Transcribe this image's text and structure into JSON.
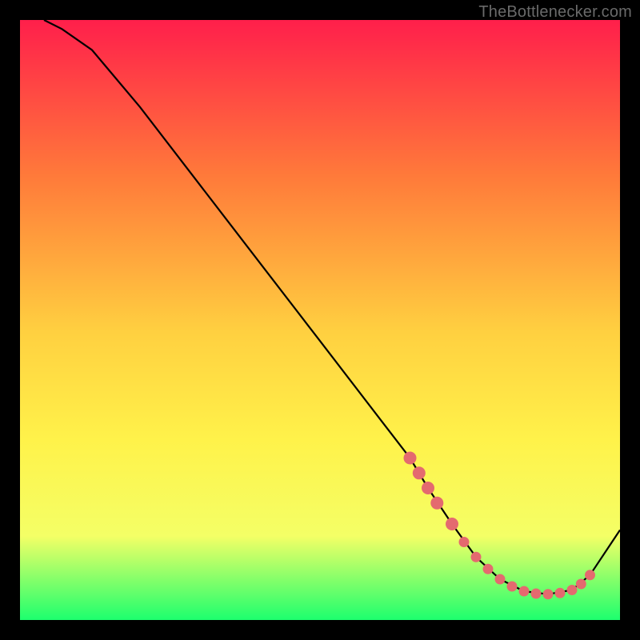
{
  "attribution": "TheBottlenecker.com",
  "colors": {
    "background": "#000000",
    "gradient_top": "#ff1f4b",
    "gradient_mid_upper": "#ff7a3a",
    "gradient_mid": "#ffd040",
    "gradient_mid_lower": "#fff24a",
    "gradient_lower": "#f4ff66",
    "gradient_bottom": "#1dff6e",
    "line": "#000000",
    "point_fill": "#e46a6f",
    "attribution_text": "#6a6a6a"
  },
  "chart_data": {
    "type": "line",
    "title": "",
    "xlabel": "",
    "ylabel": "",
    "xlim": [
      0,
      100
    ],
    "ylim": [
      0,
      100
    ],
    "series": [
      {
        "name": "curve",
        "x": [
          4,
          7,
          12,
          20,
          30,
          40,
          50,
          60,
          65,
          68,
          72,
          76,
          80,
          84,
          88,
          92,
          95,
          100
        ],
        "y": [
          100,
          98.5,
          95,
          85.5,
          72.5,
          59.5,
          46.5,
          33.5,
          27,
          22,
          16,
          10.5,
          6.8,
          4.8,
          4.3,
          5.0,
          7.5,
          15
        ]
      }
    ],
    "points": {
      "name": "markers",
      "x": [
        65,
        66.5,
        68,
        69.5,
        72,
        74,
        76,
        78,
        80,
        82,
        84,
        86,
        88,
        90,
        92,
        93.5,
        95
      ],
      "y": [
        27,
        24.5,
        22,
        19.5,
        16,
        13,
        10.5,
        8.5,
        6.8,
        5.6,
        4.8,
        4.4,
        4.3,
        4.5,
        5.0,
        6.0,
        7.5
      ]
    }
  }
}
